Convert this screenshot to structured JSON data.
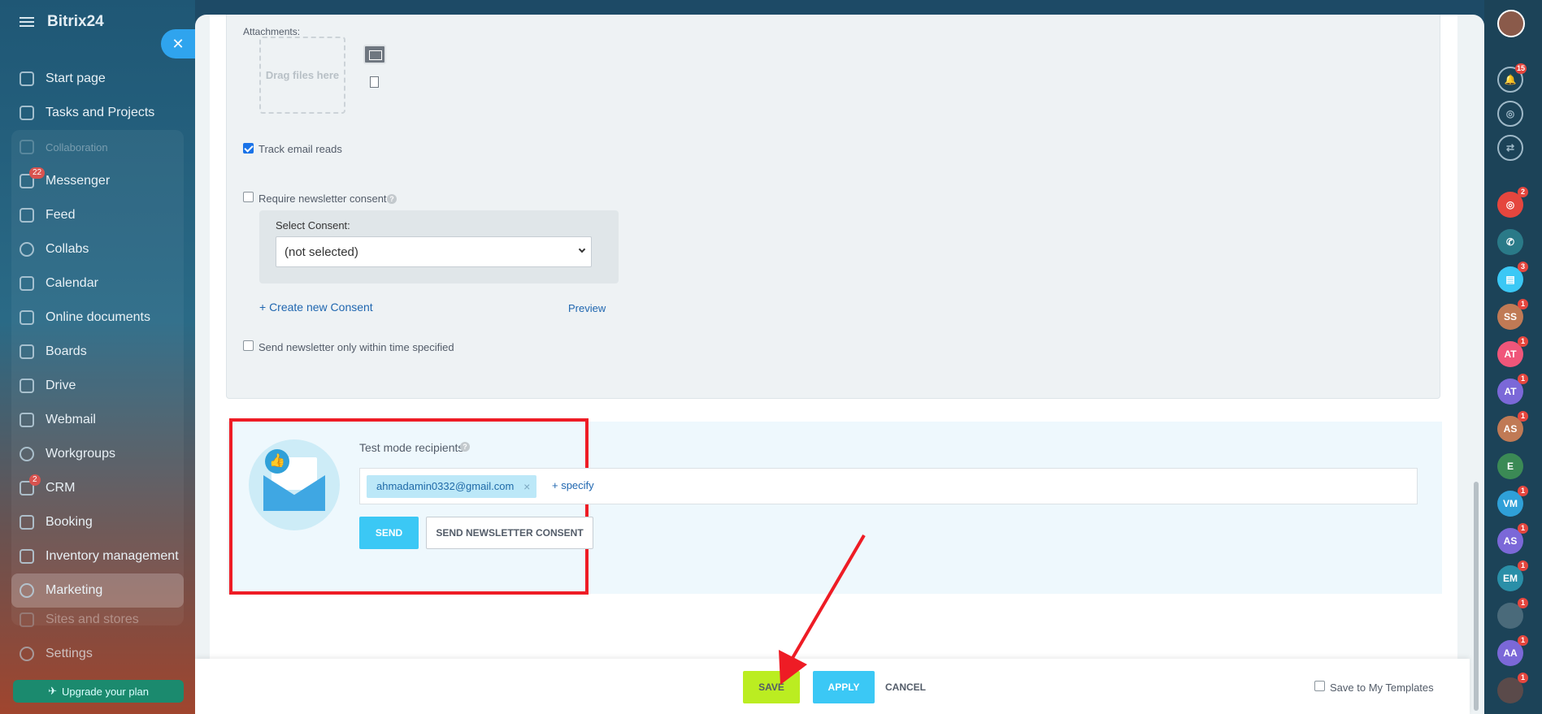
{
  "sidebar": {
    "brand": "Bitrix24",
    "items": [
      {
        "label": "Start page"
      },
      {
        "label": "Tasks and Projects"
      },
      {
        "label": "Collaboration"
      },
      {
        "label": "Messenger",
        "badge": "22"
      },
      {
        "label": "Feed"
      },
      {
        "label": "Collabs"
      },
      {
        "label": "Calendar"
      },
      {
        "label": "Online documents"
      },
      {
        "label": "Boards"
      },
      {
        "label": "Drive"
      },
      {
        "label": "Webmail"
      },
      {
        "label": "Workgroups"
      },
      {
        "label": "CRM",
        "badge": "2"
      },
      {
        "label": "Booking"
      },
      {
        "label": "Inventory management"
      },
      {
        "label": "Marketing"
      },
      {
        "label": "Sites and stores"
      },
      {
        "label": "Settings"
      }
    ],
    "upgrade": "Upgrade your plan"
  },
  "form": {
    "attachments_label": "Attachments:",
    "drag_files": "Drag files here",
    "track_reads": "Track email reads",
    "require_consent": "Require newsletter consent",
    "select_consent_label": "Select Consent:",
    "select_consent_value": "(not selected)",
    "create_consent": "+ Create new Consent",
    "preview": "Preview",
    "time_specified": "Send newsletter only within time specified"
  },
  "test": {
    "label": "Test mode recipients",
    "recipient": "ahmadamin0332@gmail.com",
    "specify": "+ specify",
    "send": "SEND",
    "send_consent": "SEND NEWSLETTER CONSENT"
  },
  "footer": {
    "save": "SAVE",
    "apply": "APPLY",
    "cancel": "CANCEL",
    "save_template": "Save to My Templates"
  },
  "rail": {
    "notif_badge": "15",
    "items": [
      {
        "initials": "SS",
        "color": "#c07a55",
        "badge": "1"
      },
      {
        "initials": "AT",
        "color": "#f0567a",
        "badge": "1"
      },
      {
        "initials": "AT",
        "color": "#7b68d8",
        "badge": "1"
      },
      {
        "initials": "AS",
        "color": "#c07a55",
        "badge": "1"
      },
      {
        "initials": "E",
        "color": "#3b8a55",
        "badge": ""
      },
      {
        "initials": "VM",
        "color": "#2fa0d8",
        "badge": "1"
      },
      {
        "initials": "AS",
        "color": "#7b68d8",
        "badge": "1"
      },
      {
        "initials": "EM",
        "color": "#2a8fa8",
        "badge": "1"
      },
      {
        "initials": "",
        "color": "#4a6a7a",
        "badge": "1"
      },
      {
        "initials": "AA",
        "color": "#7b68d8",
        "badge": "1"
      },
      {
        "initials": "",
        "color": "#5a4a4a",
        "badge": "1"
      }
    ]
  }
}
